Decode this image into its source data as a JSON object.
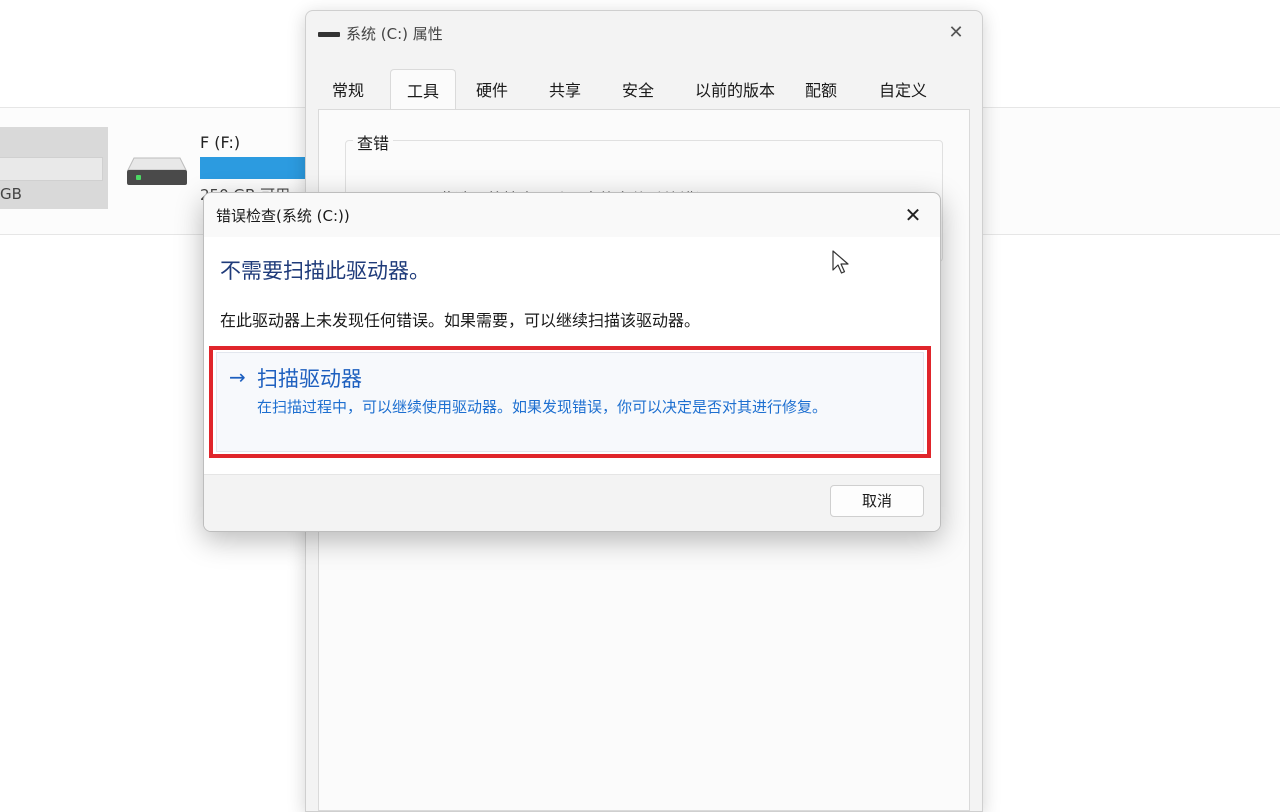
{
  "explorer": {
    "selected_drive_size": "GB",
    "drive_f": {
      "label": "F (F:)",
      "free_text": "250 GB 可用",
      "bar_color": "#2c9be0"
    }
  },
  "properties_window": {
    "title": "系统 (C:) 属性",
    "close_icon": "close-icon",
    "tabs": [
      {
        "label": "常规"
      },
      {
        "label": "工具",
        "active": true
      },
      {
        "label": "硬件"
      },
      {
        "label": "共享"
      },
      {
        "label": "安全"
      },
      {
        "label": "以前的版本"
      },
      {
        "label": "配额"
      },
      {
        "label": "自定义"
      }
    ],
    "error_check_group": {
      "label": "查错",
      "description": "此选项将检查驱动器中的文件系统错误。"
    }
  },
  "error_dialog": {
    "title": "错误检查(系统 (C:))",
    "close_icon": "close-icon",
    "heading": "不需要扫描此驱动器。",
    "message": "在此驱动器上未发现任何错误。如果需要，可以继续扫描该驱动器。",
    "scan_option": {
      "arrow_icon": "arrow-right-icon",
      "title": "扫描驱动器",
      "description": "在扫描过程中，可以继续使用驱动器。如果发现错误，你可以决定是否对其进行修复。"
    },
    "cancel_label": "取消"
  },
  "colors": {
    "highlight_border": "#e0252b",
    "link_blue": "#1d5fbf",
    "heading_blue": "#1f3b7a"
  }
}
